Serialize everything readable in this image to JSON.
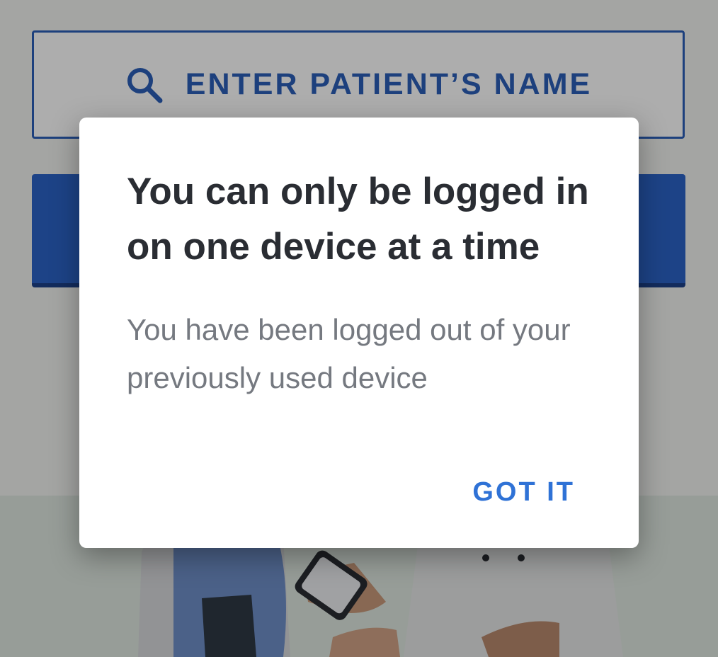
{
  "search": {
    "label": "ENTER PATIENT’S NAME",
    "icon": "search-icon"
  },
  "dialog": {
    "title": "You can only be logged in on one device at a time",
    "message": "You have been logged out of your previously used device",
    "button_label": "GOT IT"
  },
  "colors": {
    "accent": "#2b5fb8",
    "button_text": "#2f72d6",
    "title_text": "#2a2d33",
    "message_text": "#757980"
  }
}
